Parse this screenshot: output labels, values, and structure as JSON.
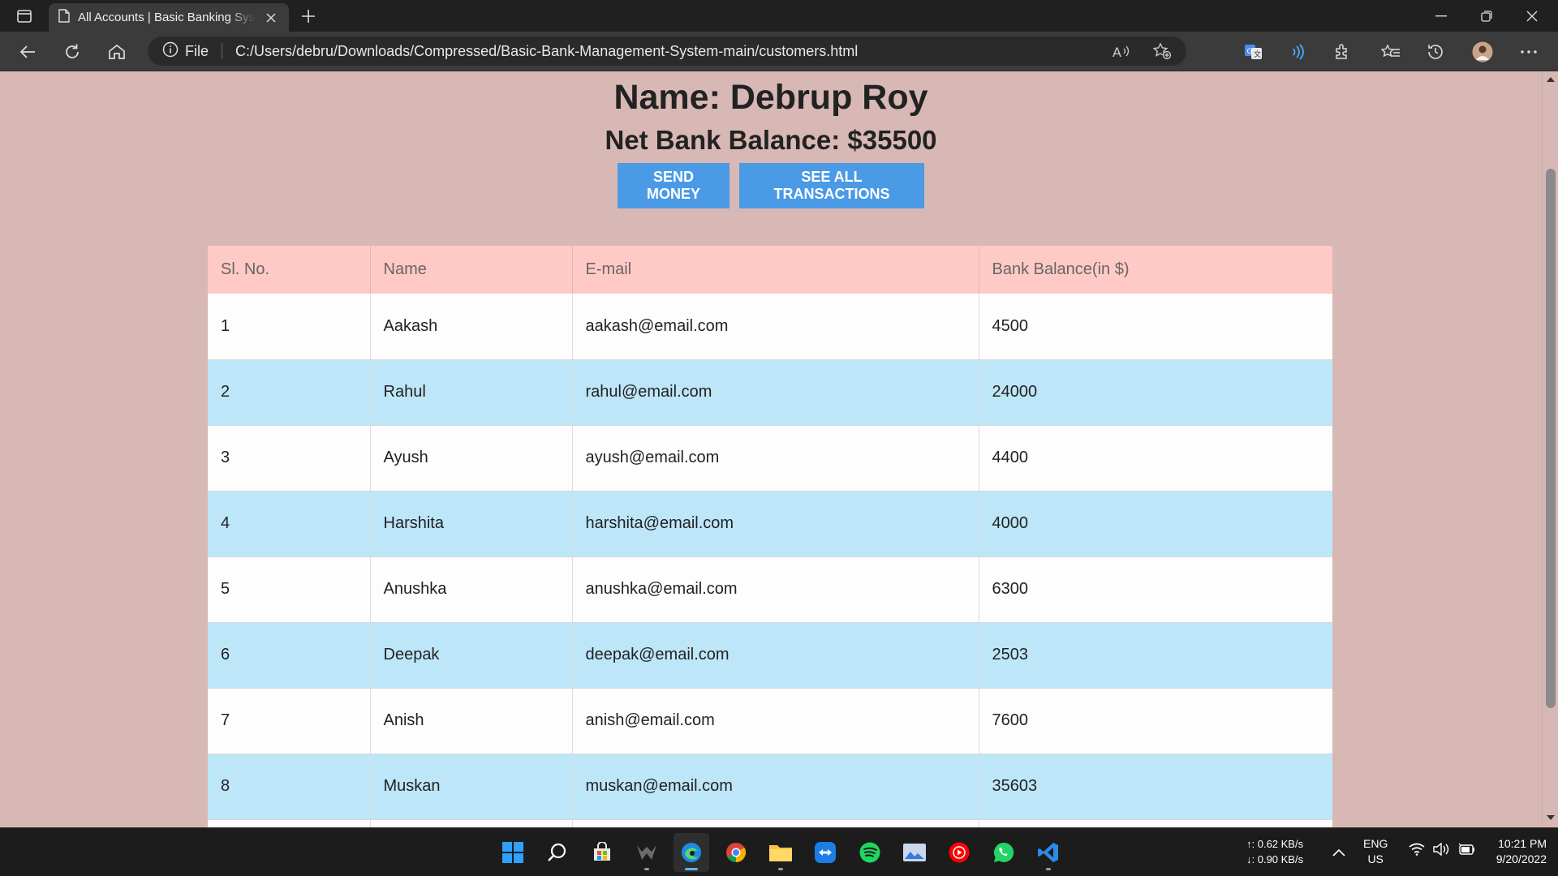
{
  "browser": {
    "tab_title": "All Accounts | Basic Banking System",
    "address_label": "File",
    "url": "C:/Users/debru/Downloads/Compressed/Basic-Bank-Management-System-main/customers.html"
  },
  "page": {
    "name_heading": "Name: Debrup Roy",
    "balance_heading": "Net Bank Balance: $35500",
    "send_money_label": "SEND MONEY",
    "see_all_label": "SEE ALL TRANSACTIONS"
  },
  "table": {
    "headers": [
      "Sl. No.",
      "Name",
      "E-mail",
      "Bank Balance(in $)"
    ],
    "rows": [
      [
        "1",
        "Aakash",
        "aakash@email.com",
        "4500"
      ],
      [
        "2",
        "Rahul",
        "rahul@email.com",
        "24000"
      ],
      [
        "3",
        "Ayush",
        "ayush@email.com",
        "4400"
      ],
      [
        "4",
        "Harshita",
        "harshita@email.com",
        "4000"
      ],
      [
        "5",
        "Anushka",
        "anushka@email.com",
        "6300"
      ],
      [
        "6",
        "Deepak",
        "deepak@email.com",
        "2503"
      ],
      [
        "7",
        "Anish",
        "anish@email.com",
        "7600"
      ],
      [
        "8",
        "Muskan",
        "muskan@email.com",
        "35603"
      ]
    ]
  },
  "taskbar": {
    "net_up": "↑: 0.62 KB/s",
    "net_down": "↓: 0.90 KB/s",
    "lang": "ENG",
    "region": "US",
    "time": "10:21 PM",
    "date": "9/20/2022"
  },
  "colors": {
    "page_bg": "#d8b8b4",
    "button": "#4a9ae6",
    "header_row": "#ffcac6",
    "alt_row": "#bde6f8"
  }
}
